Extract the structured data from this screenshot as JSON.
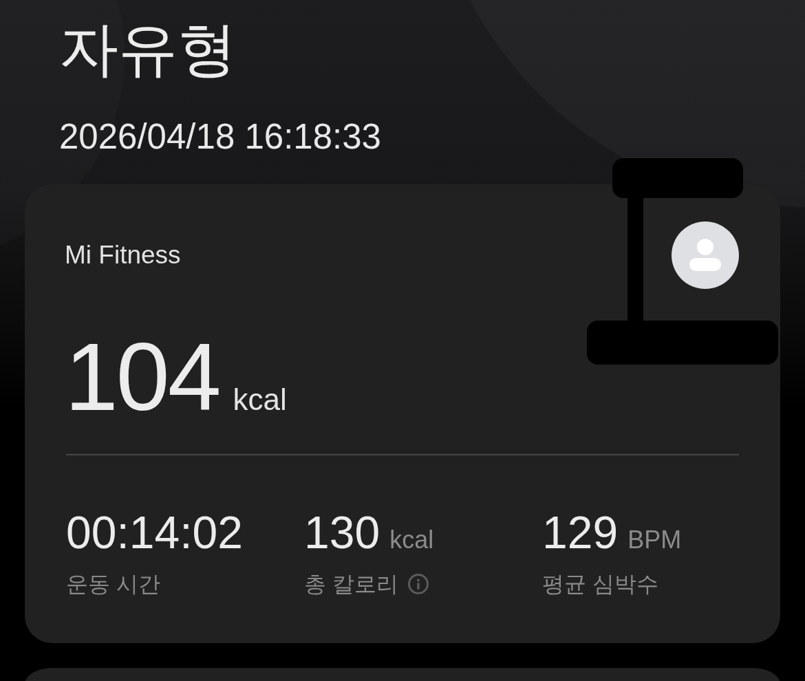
{
  "workout": {
    "title": "자유형",
    "datetime": "2026/04/18 16:18:33"
  },
  "summary_card": {
    "source": "Mi Fitness",
    "calories": {
      "value": "104",
      "unit": "kcal"
    },
    "stats": [
      {
        "value": "00:14:02",
        "label": "운동 시간",
        "info": false
      },
      {
        "value": "130",
        "unit": "kcal",
        "label": "총 칼로리",
        "info": true
      },
      {
        "value": "129",
        "unit": "BPM",
        "label": "평균 심박수",
        "info": false
      }
    ]
  }
}
